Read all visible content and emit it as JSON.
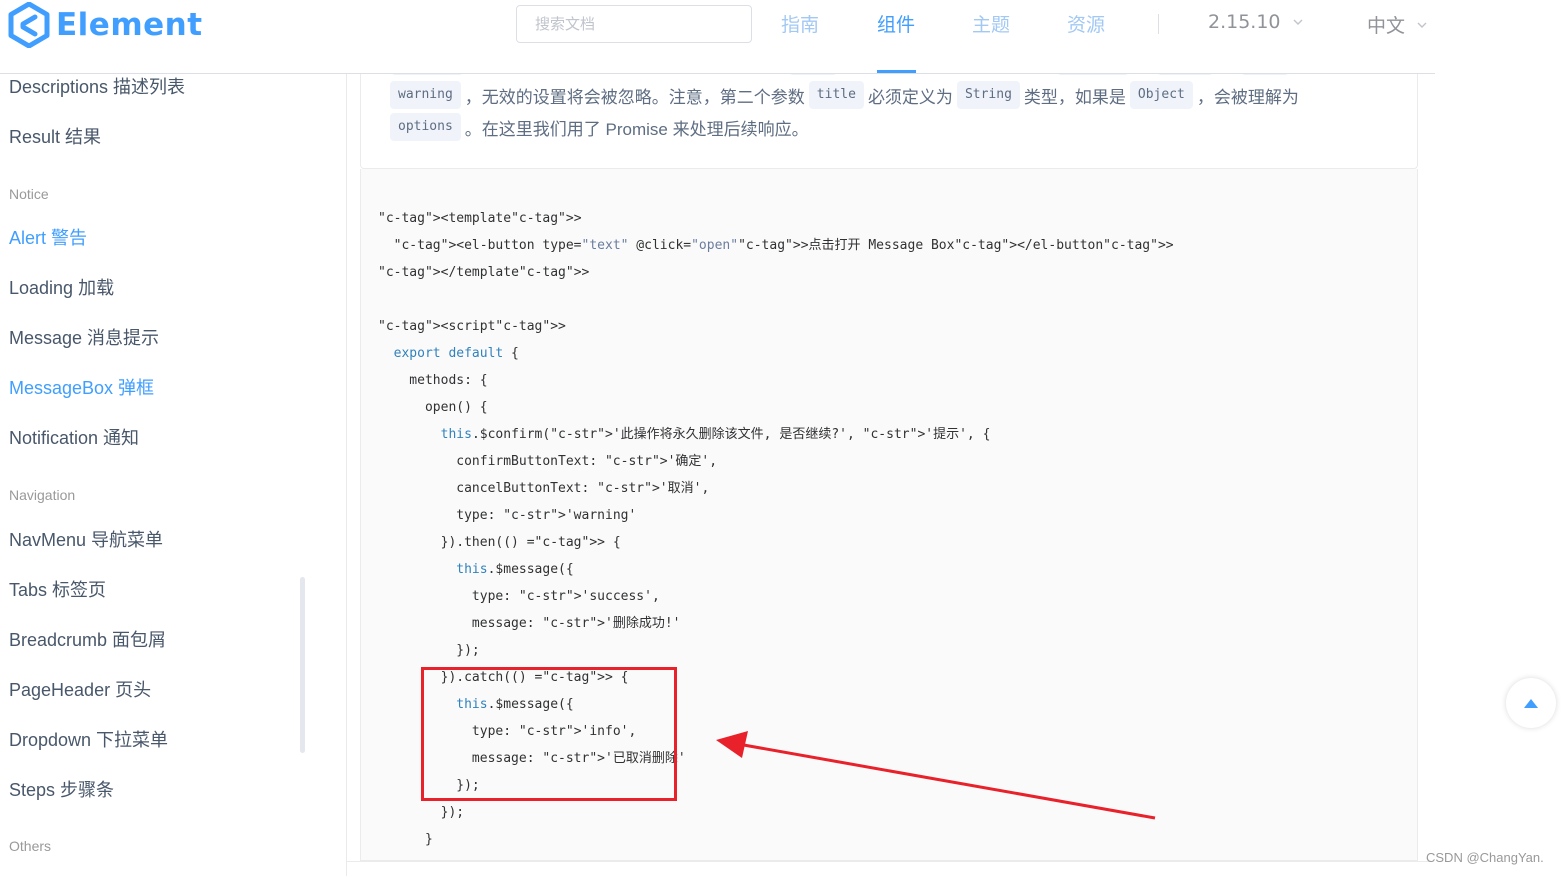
{
  "header": {
    "logo_text": "Element",
    "search_placeholder": "搜索文档",
    "nav": [
      "指南",
      "组件",
      "主题",
      "资源"
    ],
    "active_nav": "组件",
    "version": "2.15.10",
    "language": "中文"
  },
  "sidebar": {
    "items": [
      {
        "label": "Descriptions 描述列表"
      },
      {
        "label": "Result 结果"
      },
      {
        "group": "Notice"
      },
      {
        "label": "Alert 警告",
        "active": true
      },
      {
        "label": "Loading 加载"
      },
      {
        "label": "Message 消息提示"
      },
      {
        "label": "MessageBox 弹框",
        "active": true
      },
      {
        "label": "Notification 通知"
      },
      {
        "group": "Navigation"
      },
      {
        "label": "NavMenu 导航菜单"
      },
      {
        "label": "Tabs 标签页"
      },
      {
        "label": "Breadcrumb 面包屑"
      },
      {
        "label": "PageHeader 页头"
      },
      {
        "label": "Dropdown 下拉菜单"
      },
      {
        "label": "Steps 步骤条"
      },
      {
        "group": "Others"
      }
    ]
  },
  "description": {
    "line1": {
      "tag1": "warning",
      "text1": "，无效的设置将会被忽略。注意，第二个参数",
      "tag2": "title",
      "text2": "必须定义为",
      "tag3": "String",
      "text3": "类型，如果是",
      "tag4": "Object",
      "text4": "，会被理解为"
    },
    "line2": {
      "tag1": "options",
      "text1": "。在这里我们用了 Promise 来处理后续响应。"
    }
  },
  "code_lines": [
    "<template>",
    "  <el-button type=\"text\" @click=\"open\">点击打开 Message Box</el-button>",
    "</template>",
    "",
    "<script>",
    "  export default {",
    "    methods: {",
    "      open() {",
    "        this.$confirm('此操作将永久删除该文件, 是否继续?', '提示', {",
    "          confirmButtonText: '确定',",
    "          cancelButtonText: '取消',",
    "          type: 'warning'",
    "        }).then(() => {",
    "          this.$message({",
    "            type: 'success',",
    "            message: '删除成功!'",
    "          });",
    "        }).catch(() => {",
    "          this.$message({",
    "            type: 'info',",
    "            message: '已取消删除'",
    "          });",
    "        });",
    "      }"
  ],
  "colors": {
    "accent": "#409eff",
    "highlight": "#e8212b"
  },
  "watermark": "CSDN @ChangYan."
}
